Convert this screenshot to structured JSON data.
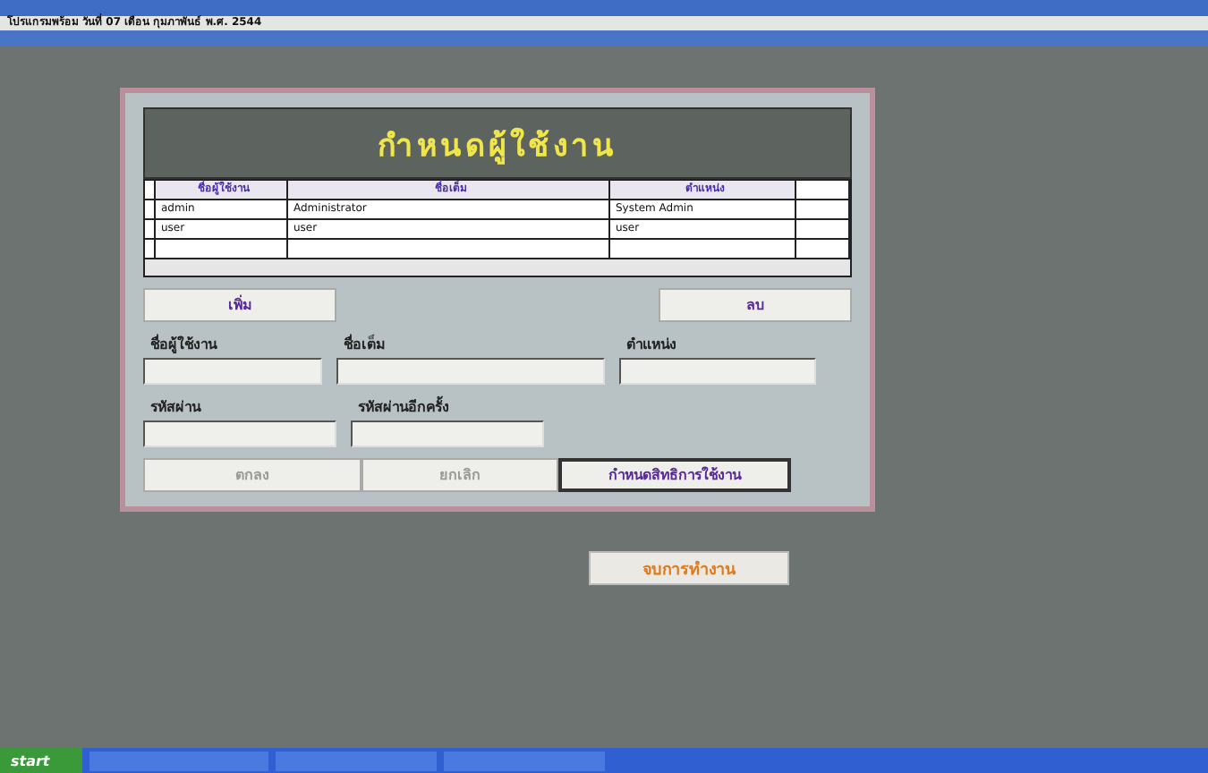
{
  "status_line": "โปรแกรมพร้อม วันที่ 07 เดือน กุมภาพันธ์ พ.ศ. 2544",
  "form": {
    "title": "กำหนดผู้ใช้งาน",
    "table": {
      "columns": [
        "ชื่อผู้ใช้งาน",
        "ชื่อเต็ม",
        "ตำแหน่ง"
      ],
      "rows": [
        [
          "admin",
          "Administrator",
          "System Admin"
        ],
        [
          "user",
          "user",
          "user"
        ]
      ]
    },
    "add_button": "เพิ่ม",
    "delete_button": "ลบ",
    "field_rows": [
      [
        {
          "label": "ชื่อผู้ใช้งาน"
        },
        {
          "label": "ชื่อเต็ม"
        },
        {
          "label": "ตำแหน่ง"
        }
      ],
      [
        {
          "label": "รหัสผ่าน"
        },
        {
          "label": "รหัสผ่านอีกครั้ง"
        }
      ]
    ],
    "buttons": [
      {
        "label": "ตกลง",
        "disabled": true
      },
      {
        "label": "ยกเลิก",
        "disabled": true
      },
      {
        "label": "กำหนดสิทธิการใช้งาน",
        "disabled": false
      }
    ]
  },
  "exit_button": "จบการทำงาน",
  "taskbar": {
    "start": "start"
  }
}
